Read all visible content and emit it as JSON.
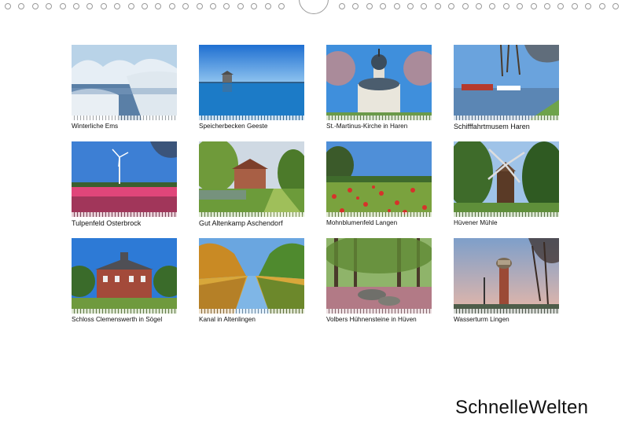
{
  "calendar": {
    "images": [
      {
        "caption": "Winterliche Ems",
        "icon": "winter-river-photo"
      },
      {
        "caption": "Speicherbecken Geeste",
        "icon": "reservoir-tower-photo"
      },
      {
        "caption": "St.-Martinus-Kirche in Haren",
        "icon": "church-dome-photo"
      },
      {
        "caption": "Schifffahrtmusem Haren",
        "icon": "harbor-ships-photo"
      },
      {
        "caption": "Tulpenfeld Osterbrock",
        "icon": "tulip-field-wind-turbine-photo"
      },
      {
        "caption": "Gut Altenkamp Aschendorf",
        "icon": "manor-park-photo"
      },
      {
        "caption": "Mohnblumenfeld Langen",
        "icon": "poppy-field-photo"
      },
      {
        "caption": "Hüvener Mühle",
        "icon": "windmill-photo"
      },
      {
        "caption": "Schloss Clemenswerth in Sögel",
        "icon": "baroque-palace-photo"
      },
      {
        "caption": "Kanal in Altenlingen",
        "icon": "autumn-canal-photo"
      },
      {
        "caption": "Volbers Hühnensteine in Hüven",
        "icon": "megalith-forest-photo"
      },
      {
        "caption": "Wasserturm Lingen",
        "icon": "water-tower-photo"
      }
    ],
    "brand": "SchnelleWelten"
  }
}
